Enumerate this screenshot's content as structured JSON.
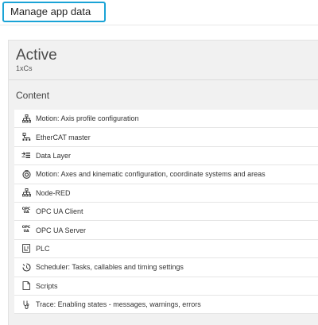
{
  "header": {
    "manage_button_label": "Manage app data"
  },
  "panel": {
    "title": "Active",
    "subtitle": "1xCs",
    "section_title": "Content"
  },
  "items": [
    {
      "label": "Motion: Axis profile configuration",
      "icon": "hierarchy-icon"
    },
    {
      "label": "EtherCAT master",
      "icon": "ethercat-icon"
    },
    {
      "label": "Data Layer",
      "icon": "data-layer-icon"
    },
    {
      "label": "Motion: Axes and kinematic configuration, coordinate systems and areas",
      "icon": "motion-target-icon"
    },
    {
      "label": "Node-RED",
      "icon": "hierarchy-icon"
    },
    {
      "label": "OPC UA Client",
      "icon": "opcua-icon"
    },
    {
      "label": "OPC UA Server",
      "icon": "opcua-icon"
    },
    {
      "label": "PLC",
      "icon": "plc-icon"
    },
    {
      "label": "Scheduler: Tasks, callables and timing settings",
      "icon": "scheduler-icon"
    },
    {
      "label": "Scripts",
      "icon": "scripts-icon"
    },
    {
      "label": "Trace: Enabling states - messages, warnings, errors",
      "icon": "trace-icon"
    }
  ]
}
